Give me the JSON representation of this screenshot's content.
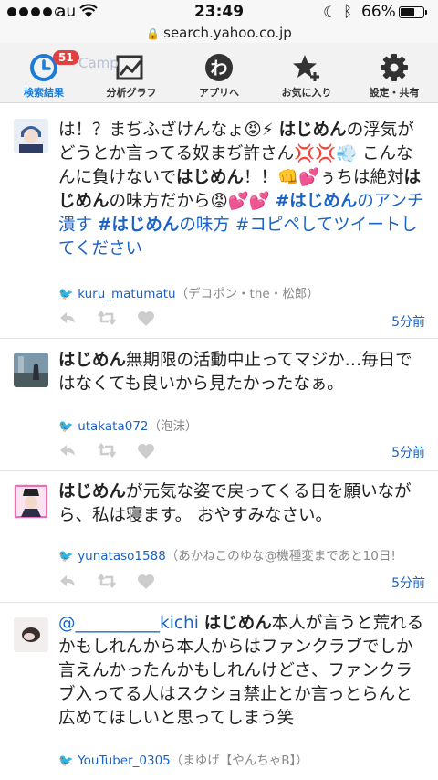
{
  "status_bar": {
    "carrier": "au",
    "time": "23:49",
    "battery_pct": "66%",
    "battery_level": 0.66
  },
  "url": "search.yahoo.co.jp",
  "toolbar": {
    "badge": "51",
    "ghost_text": "Camp",
    "items": [
      {
        "label": "検索結果",
        "icon": "clock-icon"
      },
      {
        "label": "分析グラフ",
        "icon": "chart-icon"
      },
      {
        "label": "アプリへ",
        "icon": "app-icon"
      },
      {
        "label": "お気に入り",
        "icon": "star-add-icon"
      },
      {
        "label": "設定・共有",
        "icon": "gear-icon"
      }
    ]
  },
  "tweets": [
    {
      "parts": [
        {
          "t": "は！？まぢふざけんなょ😡⚡ "
        },
        {
          "t": "はじめん",
          "b": true
        },
        {
          "t": "の浮気がどうとか言ってる奴まぢ許さん💢💢💨 こんなんに負けないで"
        },
        {
          "t": "はじめん",
          "b": true
        },
        {
          "t": "！！👊💕ぅちは絶対"
        },
        {
          "t": "はじめん",
          "b": true
        },
        {
          "t": "の味方だから😡💕💕 "
        },
        {
          "t": "#はじめん",
          "tag": true,
          "b": true
        },
        {
          "t": "のアンチ潰す",
          "tag": true
        },
        {
          "t": " "
        },
        {
          "t": "#はじめん",
          "tag": true,
          "b": true
        },
        {
          "t": "の味方",
          "tag": true
        },
        {
          "t": " "
        },
        {
          "t": "#コピペしてツイートしてください",
          "tag": true
        }
      ],
      "username": "kuru_matumatu",
      "display_name": "（デコポン・the・松郎）",
      "time": "5分前"
    },
    {
      "parts": [
        {
          "t": "はじめん",
          "b": true
        },
        {
          "t": "無期限の活動中止ってマジか…毎日ではなくても良いから見たかったなぁ。"
        }
      ],
      "username": "utakata072",
      "display_name": "（泡沫）",
      "time": "5分前"
    },
    {
      "parts": [
        {
          "t": "はじめん",
          "b": true
        },
        {
          "t": "が元気な姿で戻ってくる日を願いながら、私は寝ます。 おやすみなさい。"
        }
      ],
      "username": "yunataso1588",
      "display_name": "（あかねこのゆな@機種変まであと10日!",
      "time": "5分前"
    },
    {
      "parts": [
        {
          "t": "@__________kichi",
          "at": true
        },
        {
          "t": " "
        },
        {
          "t": "はじめん",
          "b": true
        },
        {
          "t": "本人が言うと荒れるかもしれんから本人からはファンクラブでしか言えんかったんかもしれんけどさ、ファンクラブ入ってる人はスクショ禁止とか言っとらんと広めてほしいと思ってしまう笑"
        }
      ],
      "username": "YouTuber_0305",
      "display_name": "（まゆげ【やんちゃB】）",
      "time": ""
    }
  ]
}
